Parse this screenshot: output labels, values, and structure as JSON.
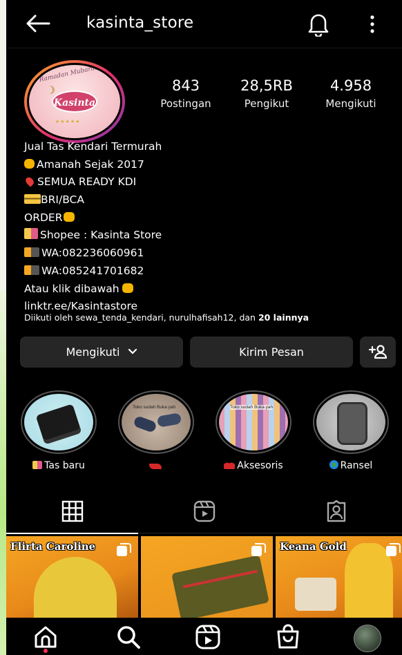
{
  "header": {
    "username": "kasinta_store"
  },
  "avatar": {
    "script_text": "Ramadan Mubarak",
    "logo_text": "Kasinta"
  },
  "stats": [
    {
      "value": "843",
      "label": "Postingan"
    },
    {
      "value": "28,5RB",
      "label": "Pengikut"
    },
    {
      "value": "4.958",
      "label": "Mengikuti"
    }
  ],
  "bio": {
    "lines": [
      {
        "text": "Jual Tas Kendari Termurah",
        "icon": ""
      },
      {
        "text": "Amanah Sejak 2017",
        "icon": "victory-hand-icon"
      },
      {
        "text": "SEMUA READY KDI",
        "icon": "pin-icon"
      },
      {
        "text": "BRI/BCA",
        "icon": "credit-card-icon"
      },
      {
        "text": "ORDER",
        "icon": "pointing-down-icon"
      },
      {
        "text": "Shopee : Kasinta Store",
        "icon": "shopping-bag-icon"
      },
      {
        "text": "WA:082236060961",
        "icon": "phone-arrow-icon"
      },
      {
        "text": "WA:085241701682",
        "icon": "phone-arrow-icon"
      },
      {
        "text": "Atau klik dibawah",
        "icon": "pointing-down-icon"
      }
    ],
    "link": "linktr.ee/Kasintastore",
    "followed_by_prefix": "Diikuti oleh sewa_tenda_kendari, nurulhafisah12, dan ",
    "followed_by_count": "20 lainnya"
  },
  "actions": {
    "follow_label": "Mengikuti",
    "message_label": "Kirim Pesan"
  },
  "highlights": [
    {
      "label": "Tas baru",
      "icon": "shopping-bag-icon",
      "caption": ""
    },
    {
      "label": "",
      "icon": "high-heel-icon",
      "caption": "Toko sudah Buka yah"
    },
    {
      "label": "Aksesoris",
      "icon": "cherries-icon",
      "caption": "Toko sudah Buka yah"
    },
    {
      "label": "Ransel",
      "icon": "globe-icon",
      "caption": ""
    }
  ],
  "grid": [
    {
      "title": "Flirta Caroline"
    },
    {
      "title": ""
    },
    {
      "title": "Keana Gold"
    }
  ],
  "colors": {
    "background": "#000000",
    "button": "#262626",
    "story_ring": "#e1306c",
    "post_orange": "#f4a52c"
  }
}
